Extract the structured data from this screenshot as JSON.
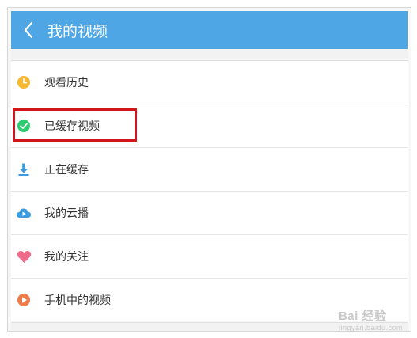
{
  "header": {
    "title": "我的视频",
    "back_icon": "back-arrow-icon"
  },
  "menu": {
    "items": [
      {
        "label": "观看历史",
        "icon": "clock-icon",
        "color": "#f7b731"
      },
      {
        "label": "已缓存视频",
        "icon": "check-circle-icon",
        "color": "#2ecc71"
      },
      {
        "label": "正在缓存",
        "icon": "download-icon",
        "color": "#3a9be0"
      },
      {
        "label": "我的云播",
        "icon": "cloud-play-icon",
        "color": "#3a9be0"
      },
      {
        "label": "我的关注",
        "icon": "heart-icon",
        "color": "#f06a8a"
      },
      {
        "label": "手机中的视频",
        "icon": "play-circle-icon",
        "color": "#f07a4a"
      }
    ]
  },
  "highlight_color": "#d0161b",
  "watermark": {
    "text": "Bai 经验",
    "sub": "jingyan.baidu.com"
  }
}
